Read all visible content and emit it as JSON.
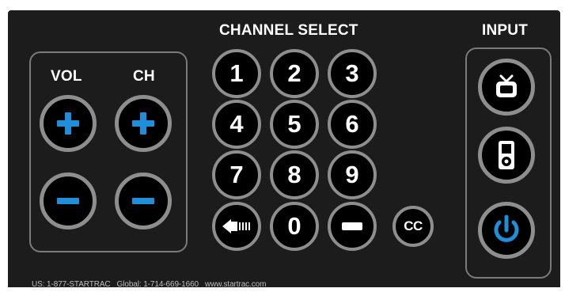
{
  "panel": {
    "channel_select_heading": "CHANNEL SELECT",
    "input_heading": "INPUT",
    "vol_label": "VOL",
    "ch_label": "CH"
  },
  "keypad": {
    "keys": [
      "1",
      "2",
      "3",
      "4",
      "5",
      "6",
      "7",
      "8",
      "9",
      "0"
    ],
    "cc_label": "CC"
  },
  "input_buttons": {
    "tv_icon": "tv-icon",
    "media_player_icon": "media-player-icon",
    "power_icon": "power-icon"
  },
  "footer": {
    "text": "US: 1-877-STARTRAC   Global: 1-714-669-1660   www.startrac.com"
  },
  "colors": {
    "panel_bg": "#1c1c1c",
    "button_ring": "#8e8e8e",
    "accent_blue": "#1e8fd8",
    "text": "#ffffff"
  }
}
